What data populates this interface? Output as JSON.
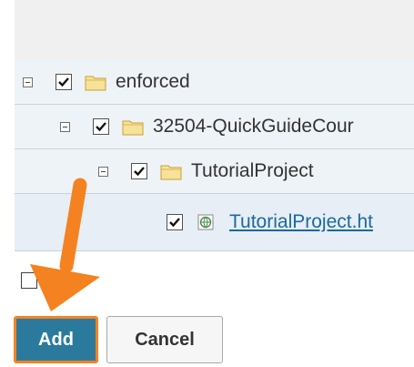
{
  "tree": {
    "rows": [
      {
        "label": "enforced",
        "checked": true,
        "icon": "folder-icon",
        "expander": "collapse"
      },
      {
        "label": "32504-QuickGuideCour",
        "checked": true,
        "icon": "folder-icon",
        "expander": "collapse"
      },
      {
        "label": "TutorialProject",
        "checked": true,
        "icon": "folder-icon",
        "expander": "collapse"
      },
      {
        "label": "TutorialProject.ht",
        "checked": true,
        "icon": "web-page-icon",
        "is_link": true
      }
    ]
  },
  "buttons": {
    "add_label": "Add",
    "cancel_label": "Cancel"
  },
  "colors": {
    "accent_orange": "#f58220",
    "add_button_bg": "#2b7a9d",
    "row_bg": "#eef3f8",
    "link": "#1a6aa0"
  },
  "annotation": {
    "icon": "orange-arrow-icon"
  }
}
